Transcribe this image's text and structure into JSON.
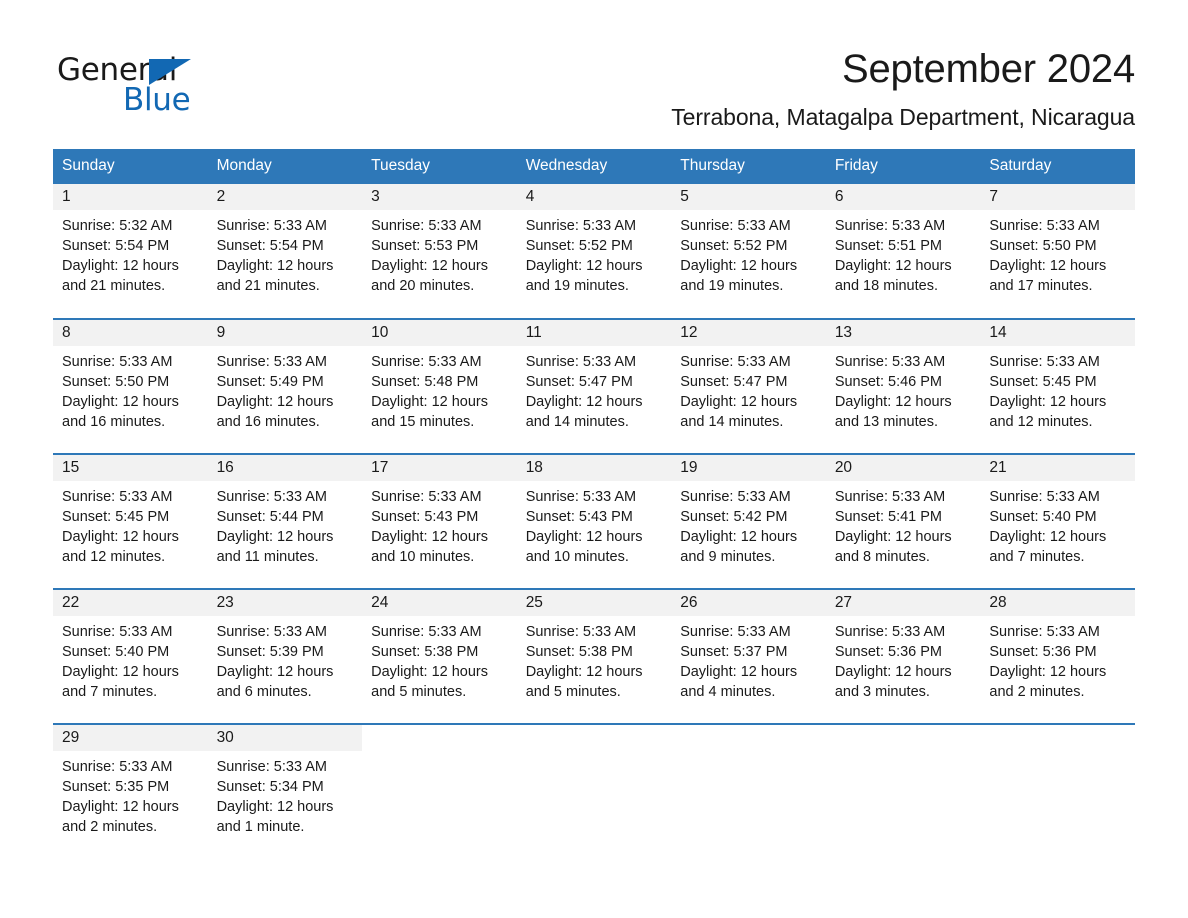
{
  "logo": {
    "word_general": "General",
    "word_blue": "Blue",
    "triangle_color": "#1268b3"
  },
  "header": {
    "month_title": "September 2024",
    "location": "Terrabona, Matagalpa Department, Nicaragua"
  },
  "theme": {
    "header_blue": "#2e78b8",
    "day_band_gray": "#f2f2f2",
    "text_color": "#1a1a1a"
  },
  "calendar": {
    "weekday_headers": [
      "Sunday",
      "Monday",
      "Tuesday",
      "Wednesday",
      "Thursday",
      "Friday",
      "Saturday"
    ],
    "weeks": [
      [
        {
          "day": "1",
          "sunrise": "Sunrise: 5:32 AM",
          "sunset": "Sunset: 5:54 PM",
          "daylight": "Daylight: 12 hours and 21 minutes."
        },
        {
          "day": "2",
          "sunrise": "Sunrise: 5:33 AM",
          "sunset": "Sunset: 5:54 PM",
          "daylight": "Daylight: 12 hours and 21 minutes."
        },
        {
          "day": "3",
          "sunrise": "Sunrise: 5:33 AM",
          "sunset": "Sunset: 5:53 PM",
          "daylight": "Daylight: 12 hours and 20 minutes."
        },
        {
          "day": "4",
          "sunrise": "Sunrise: 5:33 AM",
          "sunset": "Sunset: 5:52 PM",
          "daylight": "Daylight: 12 hours and 19 minutes."
        },
        {
          "day": "5",
          "sunrise": "Sunrise: 5:33 AM",
          "sunset": "Sunset: 5:52 PM",
          "daylight": "Daylight: 12 hours and 19 minutes."
        },
        {
          "day": "6",
          "sunrise": "Sunrise: 5:33 AM",
          "sunset": "Sunset: 5:51 PM",
          "daylight": "Daylight: 12 hours and 18 minutes."
        },
        {
          "day": "7",
          "sunrise": "Sunrise: 5:33 AM",
          "sunset": "Sunset: 5:50 PM",
          "daylight": "Daylight: 12 hours and 17 minutes."
        }
      ],
      [
        {
          "day": "8",
          "sunrise": "Sunrise: 5:33 AM",
          "sunset": "Sunset: 5:50 PM",
          "daylight": "Daylight: 12 hours and 16 minutes."
        },
        {
          "day": "9",
          "sunrise": "Sunrise: 5:33 AM",
          "sunset": "Sunset: 5:49 PM",
          "daylight": "Daylight: 12 hours and 16 minutes."
        },
        {
          "day": "10",
          "sunrise": "Sunrise: 5:33 AM",
          "sunset": "Sunset: 5:48 PM",
          "daylight": "Daylight: 12 hours and 15 minutes."
        },
        {
          "day": "11",
          "sunrise": "Sunrise: 5:33 AM",
          "sunset": "Sunset: 5:47 PM",
          "daylight": "Daylight: 12 hours and 14 minutes."
        },
        {
          "day": "12",
          "sunrise": "Sunrise: 5:33 AM",
          "sunset": "Sunset: 5:47 PM",
          "daylight": "Daylight: 12 hours and 14 minutes."
        },
        {
          "day": "13",
          "sunrise": "Sunrise: 5:33 AM",
          "sunset": "Sunset: 5:46 PM",
          "daylight": "Daylight: 12 hours and 13 minutes."
        },
        {
          "day": "14",
          "sunrise": "Sunrise: 5:33 AM",
          "sunset": "Sunset: 5:45 PM",
          "daylight": "Daylight: 12 hours and 12 minutes."
        }
      ],
      [
        {
          "day": "15",
          "sunrise": "Sunrise: 5:33 AM",
          "sunset": "Sunset: 5:45 PM",
          "daylight": "Daylight: 12 hours and 12 minutes."
        },
        {
          "day": "16",
          "sunrise": "Sunrise: 5:33 AM",
          "sunset": "Sunset: 5:44 PM",
          "daylight": "Daylight: 12 hours and 11 minutes."
        },
        {
          "day": "17",
          "sunrise": "Sunrise: 5:33 AM",
          "sunset": "Sunset: 5:43 PM",
          "daylight": "Daylight: 12 hours and 10 minutes."
        },
        {
          "day": "18",
          "sunrise": "Sunrise: 5:33 AM",
          "sunset": "Sunset: 5:43 PM",
          "daylight": "Daylight: 12 hours and 10 minutes."
        },
        {
          "day": "19",
          "sunrise": "Sunrise: 5:33 AM",
          "sunset": "Sunset: 5:42 PM",
          "daylight": "Daylight: 12 hours and 9 minutes."
        },
        {
          "day": "20",
          "sunrise": "Sunrise: 5:33 AM",
          "sunset": "Sunset: 5:41 PM",
          "daylight": "Daylight: 12 hours and 8 minutes."
        },
        {
          "day": "21",
          "sunrise": "Sunrise: 5:33 AM",
          "sunset": "Sunset: 5:40 PM",
          "daylight": "Daylight: 12 hours and 7 minutes."
        }
      ],
      [
        {
          "day": "22",
          "sunrise": "Sunrise: 5:33 AM",
          "sunset": "Sunset: 5:40 PM",
          "daylight": "Daylight: 12 hours and 7 minutes."
        },
        {
          "day": "23",
          "sunrise": "Sunrise: 5:33 AM",
          "sunset": "Sunset: 5:39 PM",
          "daylight": "Daylight: 12 hours and 6 minutes."
        },
        {
          "day": "24",
          "sunrise": "Sunrise: 5:33 AM",
          "sunset": "Sunset: 5:38 PM",
          "daylight": "Daylight: 12 hours and 5 minutes."
        },
        {
          "day": "25",
          "sunrise": "Sunrise: 5:33 AM",
          "sunset": "Sunset: 5:38 PM",
          "daylight": "Daylight: 12 hours and 5 minutes."
        },
        {
          "day": "26",
          "sunrise": "Sunrise: 5:33 AM",
          "sunset": "Sunset: 5:37 PM",
          "daylight": "Daylight: 12 hours and 4 minutes."
        },
        {
          "day": "27",
          "sunrise": "Sunrise: 5:33 AM",
          "sunset": "Sunset: 5:36 PM",
          "daylight": "Daylight: 12 hours and 3 minutes."
        },
        {
          "day": "28",
          "sunrise": "Sunrise: 5:33 AM",
          "sunset": "Sunset: 5:36 PM",
          "daylight": "Daylight: 12 hours and 2 minutes."
        }
      ],
      [
        {
          "day": "29",
          "sunrise": "Sunrise: 5:33 AM",
          "sunset": "Sunset: 5:35 PM",
          "daylight": "Daylight: 12 hours and 2 minutes."
        },
        {
          "day": "30",
          "sunrise": "Sunrise: 5:33 AM",
          "sunset": "Sunset: 5:34 PM",
          "daylight": "Daylight: 12 hours and 1 minute."
        },
        {
          "day": "",
          "sunrise": "",
          "sunset": "",
          "daylight": ""
        },
        {
          "day": "",
          "sunrise": "",
          "sunset": "",
          "daylight": ""
        },
        {
          "day": "",
          "sunrise": "",
          "sunset": "",
          "daylight": ""
        },
        {
          "day": "",
          "sunrise": "",
          "sunset": "",
          "daylight": ""
        },
        {
          "day": "",
          "sunrise": "",
          "sunset": "",
          "daylight": ""
        }
      ]
    ]
  }
}
